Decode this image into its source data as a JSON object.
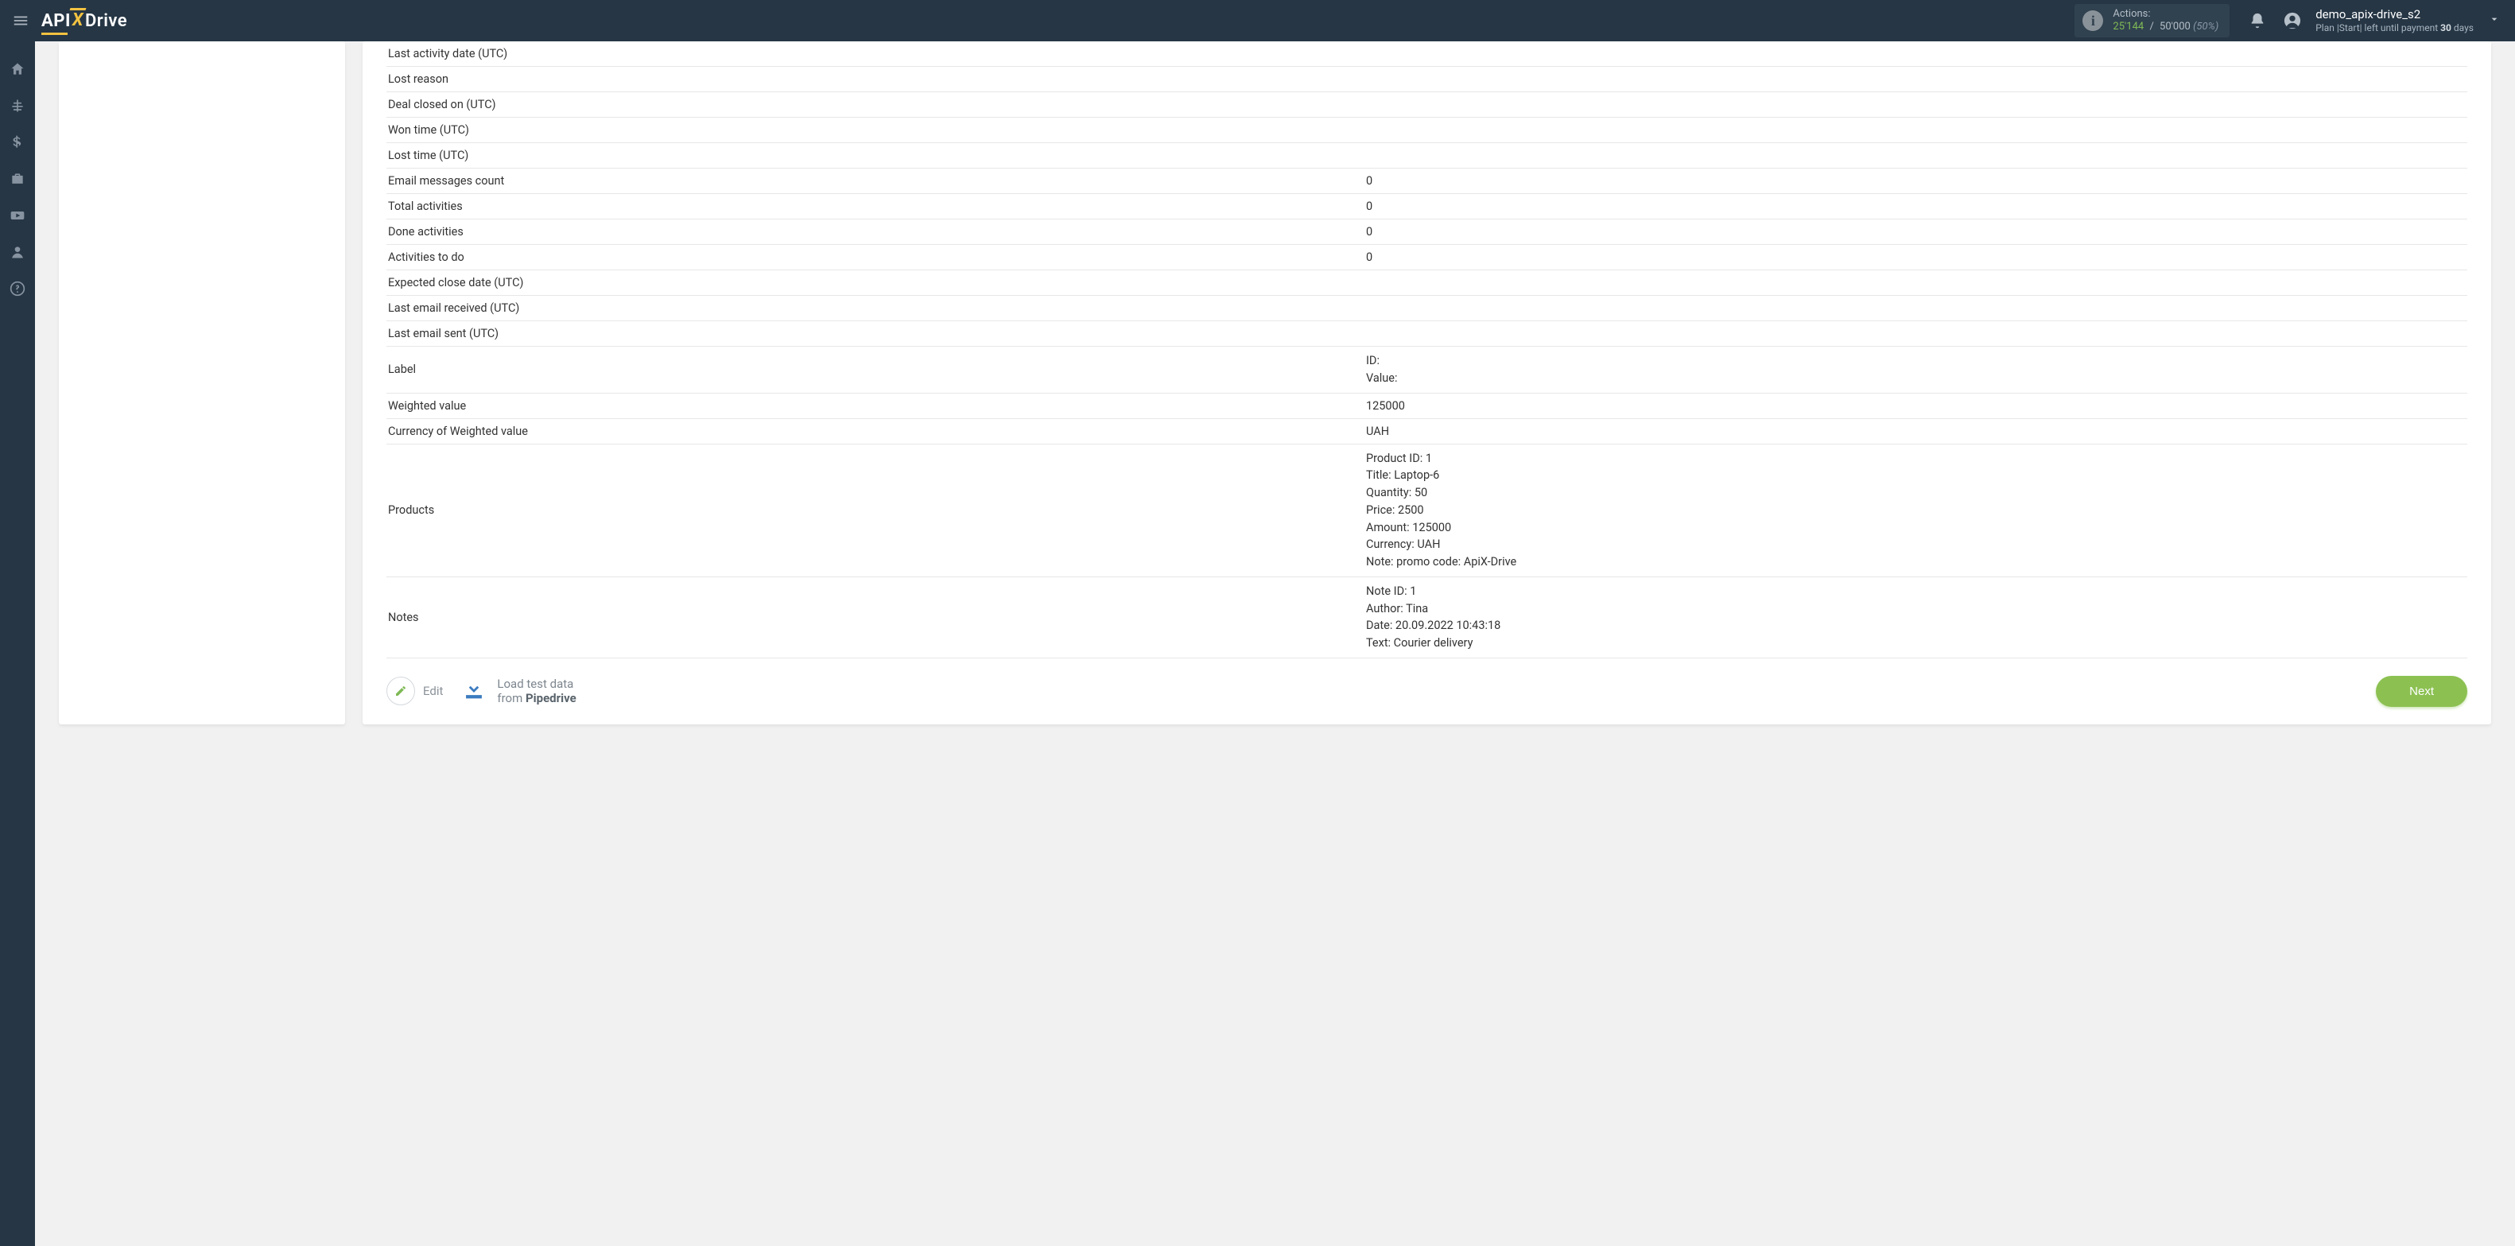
{
  "brand": {
    "part1": "API",
    "part2": "X",
    "part3": "Drive"
  },
  "header": {
    "actions": {
      "label": "Actions:",
      "current": "25'144",
      "separator": "/",
      "max": "50'000",
      "percent": "(50%)"
    },
    "user": {
      "name": "demo_apix-drive_s2",
      "plan_prefix": "Plan |Start| left until payment ",
      "plan_days": "30",
      "plan_suffix": " days"
    }
  },
  "rows": [
    {
      "label": "Last activity date (UTC)",
      "value": ""
    },
    {
      "label": "Lost reason",
      "value": ""
    },
    {
      "label": "Deal closed on (UTC)",
      "value": ""
    },
    {
      "label": "Won time (UTC)",
      "value": ""
    },
    {
      "label": "Lost time (UTC)",
      "value": ""
    },
    {
      "label": "Email messages count",
      "value": "0"
    },
    {
      "label": "Total activities",
      "value": "0"
    },
    {
      "label": "Done activities",
      "value": "0"
    },
    {
      "label": "Activities to do",
      "value": "0"
    },
    {
      "label": "Expected close date (UTC)",
      "value": ""
    },
    {
      "label": "Last email received (UTC)",
      "value": ""
    },
    {
      "label": "Last email sent (UTC)",
      "value": ""
    }
  ],
  "label_row": {
    "label": "Label",
    "id": "ID:",
    "value": "Value:"
  },
  "weighted": {
    "label": "Weighted value",
    "value": "125000"
  },
  "currency_weighted": {
    "label": "Currency of Weighted value",
    "value": "UAH"
  },
  "products": {
    "label": "Products",
    "lines": [
      "Product ID: 1",
      "Title: Laptop-6",
      "Quantity: 50",
      "Price: 2500",
      "Amount: 125000",
      "Currency: UAH",
      "Note: promo code: ApiX-Drive"
    ]
  },
  "notes": {
    "label": "Notes",
    "lines": [
      "Note ID: 1",
      "Author: Tina",
      "Date: 20.09.2022 10:43:18",
      "Text: Courier delivery"
    ]
  },
  "footer": {
    "edit": "Edit",
    "load_line1": "Load test data",
    "load_line2_a": "from ",
    "load_line2_b": "Pipedrive",
    "next": "Next"
  }
}
